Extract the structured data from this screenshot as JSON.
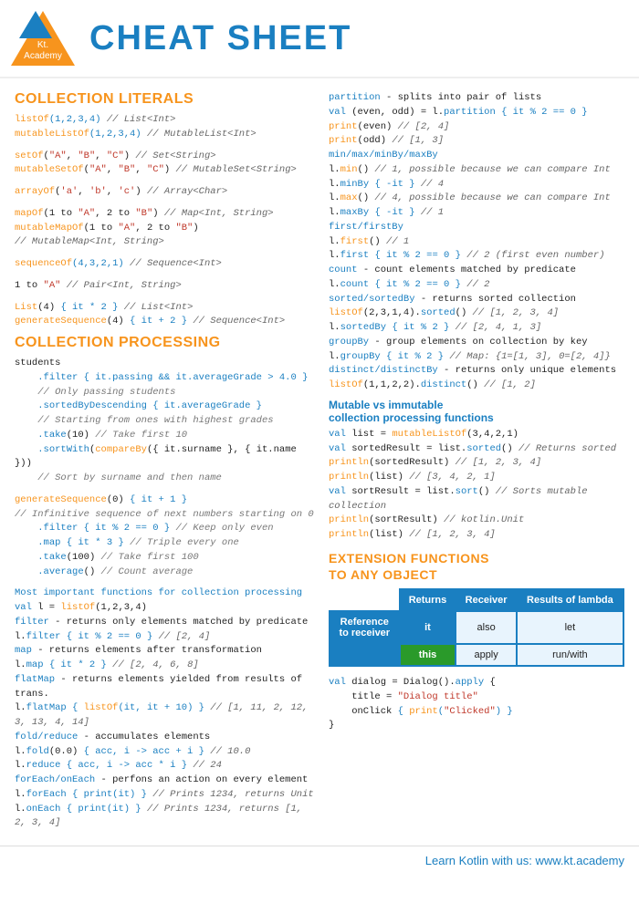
{
  "header": {
    "logo_line1": "Kt.",
    "logo_line2": "Academy",
    "title": "CHEAT SHEET"
  },
  "footer": {
    "text": "Learn Kotlin with us: www.kt.academy"
  },
  "left": {
    "section1_title": "COLLECTION LITERALS",
    "section2_title": "COLLECTION PROCESSING"
  },
  "right": {
    "section1_subtitle": "Mutable vs immutable",
    "section1_subtitle2": "collection processing functions",
    "section2_title": "EXTENSION FUNCTIONS\nTO ANY OBJECT"
  },
  "table": {
    "col1": "Returns",
    "col2": "Receiver",
    "col3": "Results of lambda",
    "row_header": "Reference\nto receiver",
    "row1_label": "it",
    "row1_col2": "also",
    "row1_col3": "let",
    "row2_label": "this",
    "row2_col2": "apply",
    "row2_col3": "run/with"
  }
}
